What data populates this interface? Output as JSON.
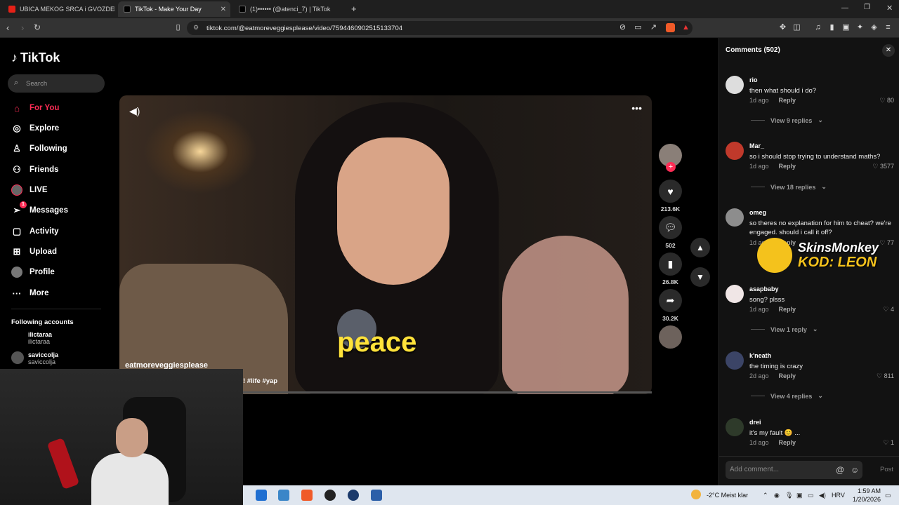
{
  "browser": {
    "tabs": [
      {
        "title": "UBICA MEKOG SRCA i GVOZDENE PE",
        "active": false
      },
      {
        "title": "TikTok - Make Your Day",
        "active": true
      },
      {
        "title": "(1)•••••• (@atenci_7) | TikTok",
        "active": false
      }
    ],
    "url": "tiktok.com/@eatmoreveggiesplease/video/7594460902515133704"
  },
  "sidebar": {
    "logo": "TikTok",
    "search_placeholder": "Search",
    "nav": [
      {
        "label": "For You",
        "icon": "home-icon",
        "active": true
      },
      {
        "label": "Explore",
        "icon": "compass-icon"
      },
      {
        "label": "Following",
        "icon": "user-plus-icon"
      },
      {
        "label": "Friends",
        "icon": "friends-icon"
      },
      {
        "label": "LIVE",
        "icon": "live-icon"
      },
      {
        "label": "Messages",
        "icon": "send-icon",
        "badge": "1"
      },
      {
        "label": "Activity",
        "icon": "inbox-icon"
      },
      {
        "label": "Upload",
        "icon": "upload-icon"
      },
      {
        "label": "Profile",
        "icon": "profile-icon"
      },
      {
        "label": "More",
        "icon": "more-icon"
      }
    ],
    "following_header": "Following accounts",
    "following": [
      {
        "name": "ilictaraa",
        "handle": "ilictaraa"
      },
      {
        "name": "saviccolja",
        "handle": "saviccolja"
      }
    ]
  },
  "video": {
    "caption": "peace",
    "author": "eatmoreveggiesplease",
    "hashtags": "! #life #yap",
    "actions": {
      "likes": "213.6K",
      "comments": "502",
      "saves": "26.8K",
      "shares": "30.2K"
    }
  },
  "comments_panel": {
    "title": "Comments (502)",
    "comments": [
      {
        "user": "rio",
        "text": "then what should i do?",
        "time": "1d ago",
        "likes": "80",
        "replies": "View 9 replies"
      },
      {
        "user": "Mar_",
        "text": "so i should stop trying to understand maths?",
        "time": "1d ago",
        "likes": "3577",
        "replies": "View 18 replies"
      },
      {
        "user": "omeg",
        "text": "so theres no explanation for him to cheat? we're engaged. should i call it off?",
        "time": "1d ago",
        "likes": "77",
        "replies": ""
      },
      {
        "user": "asapbaby",
        "text": "song? plsss",
        "time": "1d ago",
        "likes": "4",
        "replies": "View 1 reply"
      },
      {
        "user": "k'neath",
        "text": "the timing is crazy",
        "time": "2d ago",
        "likes": "811",
        "replies": "View 4 replies"
      },
      {
        "user": "drei",
        "text": "it's my fault 😊 ...",
        "time": "1d ago",
        "likes": "1",
        "replies": ""
      }
    ],
    "reply_label": "Reply",
    "add_placeholder": "Add comment...",
    "post_label": "Post"
  },
  "sponsor": {
    "brand": "SkinsMonkey",
    "code": "KOD: LEON"
  },
  "taskbar": {
    "weather": "-2°C  Meist klar",
    "lang": "HRV",
    "time": "1:59 AM",
    "date": "1/20/2026"
  }
}
